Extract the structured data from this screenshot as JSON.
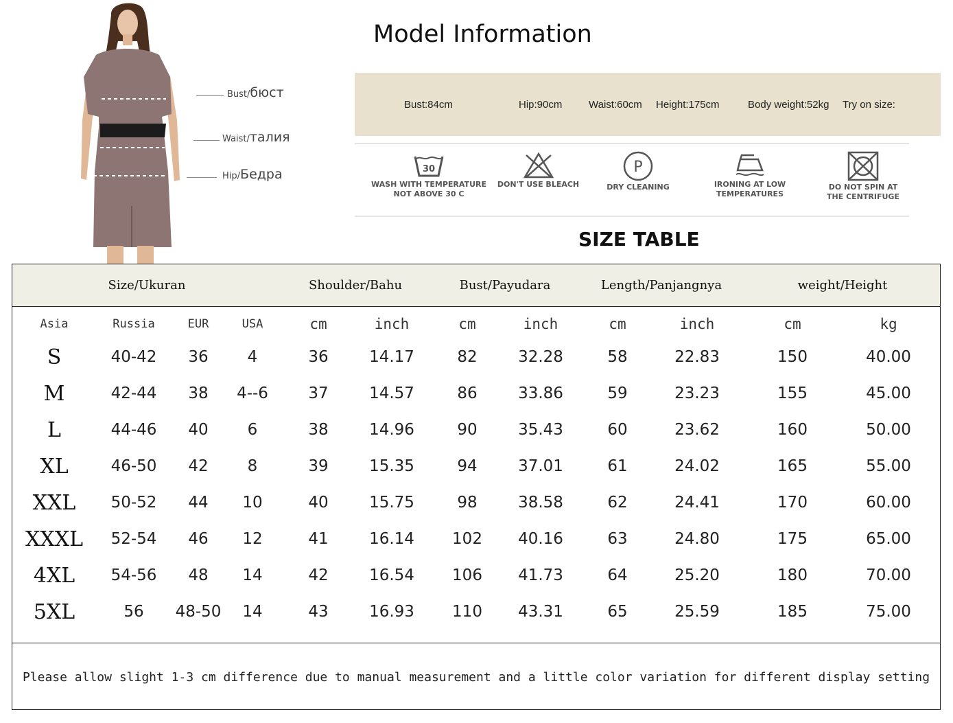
{
  "measurement_labels": {
    "bust_en": "Bust/",
    "bust_ru": "бюст",
    "waist_en": "Waist/",
    "waist_ru": "талия",
    "hip_en": "Hip/",
    "hip_ru": "Бедра"
  },
  "model_info": {
    "title": "Model Information",
    "bust": "Bust:84cm",
    "hip": "Hip:90cm",
    "waist": "Waist:60cm",
    "height": "Height:175cm",
    "weight": "Body weight:52kg",
    "try_on": "Try on size:"
  },
  "care": [
    {
      "icon": "wash-30-icon",
      "line1": "WASH WITH TEMPERATURE",
      "line2": "NOT ABOVE 30 C",
      "badge": "30"
    },
    {
      "icon": "no-bleach-icon",
      "line1": "DON'T USE BLEACH",
      "line2": ""
    },
    {
      "icon": "dry-cleaning-icon",
      "line1": "DRY CLEANING",
      "line2": "",
      "badge": "P"
    },
    {
      "icon": "iron-low-icon",
      "line1": "IRONING AT LOW",
      "line2": "TEMPERATURES"
    },
    {
      "icon": "no-spin-icon",
      "line1": "DO NOT SPIN AT",
      "line2": "THE CENTRIFUGE"
    }
  ],
  "size_table": {
    "title": "SIZE TABLE",
    "group_headers": [
      "Size/Ukuran",
      "Shoulder/Bahu",
      "Bust/Payudara",
      "Length/Panjangnya",
      "weight/Height"
    ],
    "sub_headers": [
      "Asia",
      "Russia",
      "EUR",
      "USA",
      "cm",
      "inch",
      "cm",
      "inch",
      "cm",
      "inch",
      "cm",
      "kg"
    ],
    "rows": [
      [
        "S",
        "40-42",
        "36",
        "4",
        "36",
        "14.17",
        "82",
        "32.28",
        "58",
        "22.83",
        "150",
        "40.00"
      ],
      [
        "M",
        "42-44",
        "38",
        "4--6",
        "37",
        "14.57",
        "86",
        "33.86",
        "59",
        "23.23",
        "155",
        "45.00"
      ],
      [
        "L",
        "44-46",
        "40",
        "6",
        "38",
        "14.96",
        "90",
        "35.43",
        "60",
        "23.62",
        "160",
        "50.00"
      ],
      [
        "XL",
        "46-50",
        "42",
        "8",
        "39",
        "15.35",
        "94",
        "37.01",
        "61",
        "24.02",
        "165",
        "55.00"
      ],
      [
        "XXL",
        "50-52",
        "44",
        "10",
        "40",
        "15.75",
        "98",
        "38.58",
        "62",
        "24.41",
        "170",
        "60.00"
      ],
      [
        "XXXL",
        "52-54",
        "46",
        "12",
        "41",
        "16.14",
        "102",
        "40.16",
        "63",
        "24.80",
        "175",
        "65.00"
      ],
      [
        "4XL",
        "54-56",
        "48",
        "14",
        "42",
        "16.54",
        "106",
        "41.73",
        "64",
        "25.20",
        "180",
        "70.00"
      ],
      [
        "5XL",
        "56",
        "48-50",
        "14",
        "43",
        "16.93",
        "110",
        "43.31",
        "65",
        "25.59",
        "185",
        "75.00"
      ]
    ],
    "note": "Please allow slight 1-3 cm difference due to manual measurement and a little color variation for different display setting"
  }
}
